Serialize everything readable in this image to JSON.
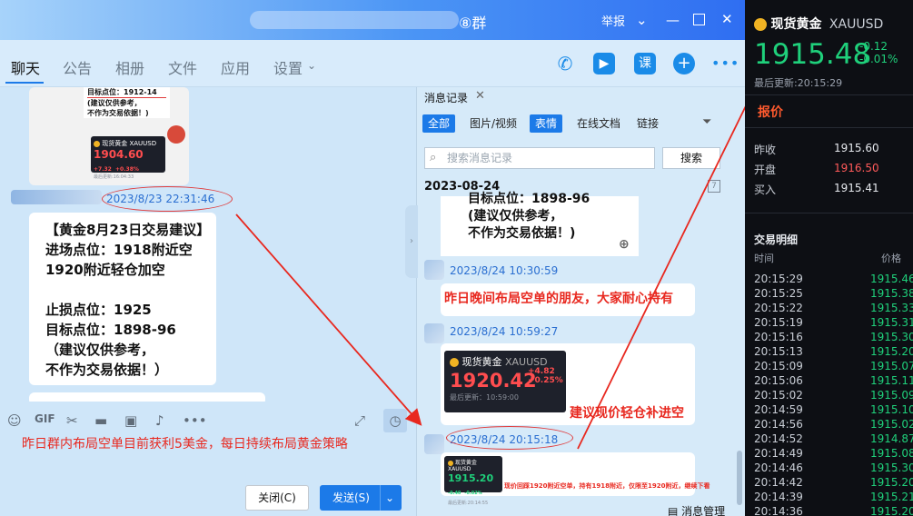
{
  "window": {
    "title_suffix": "⑧群",
    "report": "举报"
  },
  "tabs": [
    "聊天",
    "公告",
    "相册",
    "文件",
    "应用",
    "设置"
  ],
  "chat": {
    "mini_quote_lines": [
      "目标点位：1912-14",
      "(建议仅供参考，",
      "不作为交易依据！)"
    ],
    "mini_card": {
      "name": "现货黄金",
      "symbol": "XAUUSD",
      "price": "1904.60",
      "change": "+7.32",
      "pct": "+0.38%",
      "updated": "最后更新:16:04:33"
    },
    "timestamp": "2023/8/23 22:31:46",
    "message_lines": [
      "【黄金8月23日交易建议】",
      "进场点位：1918附近空",
      "1920附近轻仓加空",
      "",
      "止损点位：1925",
      "目标点位：1898-96",
      "（建议仅供参考，",
      "不作为交易依据！）"
    ],
    "caption": "昨日群内布局空单目前获利5美金，每日持续布局黄金策略",
    "close_button": "关闭(C)",
    "send_button": "发送(S)"
  },
  "history": {
    "title": "消息记录",
    "filters": [
      "全部",
      "图片/视频",
      "表情",
      "在线文档",
      "链接"
    ],
    "search_placeholder": "搜索消息记录",
    "search_button": "搜索",
    "date": "2023-08-24",
    "quote_lines": [
      "目标点位：1898-96",
      "(建议仅供参考，",
      "不作为交易依据！)"
    ],
    "ts1": "2023/8/24 10:30:59",
    "msg1": "昨日晚间布局空单的朋友，大家耐心持有",
    "ts2": "2023/8/24 10:59:27",
    "card2": {
      "name": "现货黄金",
      "symbol": "XAUUSD",
      "price": "1920.42",
      "change": "+4.82",
      "pct": "+0.25%",
      "updated": "最后更新：10:59:00"
    },
    "msg2": "建议现价轻仓补进空",
    "ts3": "2023/8/24 20:15:18",
    "card3": {
      "name": "现货黄金",
      "symbol": "XAUUSD",
      "price": "1915.20",
      "change": "-0.40",
      "pct": "-0.02%",
      "updated": "最后更新:20:14:55"
    },
    "msg3": "现价回踩1920附近空单，持有1918附近，仅限至1920附近，继续下看",
    "manage": "消息管理"
  },
  "quote": {
    "name": "现货黄金",
    "symbol": "XAUUSD",
    "price": "1915.48",
    "change": "-0.12",
    "pct": "-0.01%",
    "updated": "最后更新:20:15:29",
    "section": "报价",
    "stats": [
      {
        "label": "昨收",
        "value": "1915.60"
      },
      {
        "label": "开盘",
        "value": "1916.50"
      },
      {
        "label": "买入",
        "value": "1915.41"
      }
    ],
    "trades_title": "交易明细",
    "col_time": "时间",
    "col_price": "价格",
    "trades": [
      {
        "time": "20:15:29",
        "price": "1915.46"
      },
      {
        "time": "20:15:25",
        "price": "1915.38"
      },
      {
        "time": "20:15:22",
        "price": "1915.33"
      },
      {
        "time": "20:15:19",
        "price": "1915.31"
      },
      {
        "time": "20:15:16",
        "price": "1915.30"
      },
      {
        "time": "20:15:13",
        "price": "1915.20"
      },
      {
        "time": "20:15:09",
        "price": "1915.07"
      },
      {
        "time": "20:15:06",
        "price": "1915.11"
      },
      {
        "time": "20:15:02",
        "price": "1915.09"
      },
      {
        "time": "20:14:59",
        "price": "1915.10"
      },
      {
        "time": "20:14:56",
        "price": "1915.02"
      },
      {
        "time": "20:14:52",
        "price": "1914.87"
      },
      {
        "time": "20:14:49",
        "price": "1915.08"
      },
      {
        "time": "20:14:46",
        "price": "1915.30"
      },
      {
        "time": "20:14:42",
        "price": "1915.20"
      },
      {
        "time": "20:14:39",
        "price": "1915.21"
      },
      {
        "time": "20:14:36",
        "price": "1915.20"
      }
    ]
  },
  "colors": {
    "accent": "#1c7ae8",
    "red": "#e8281f",
    "green": "#1fd07b",
    "panel": "#0d0f14"
  }
}
